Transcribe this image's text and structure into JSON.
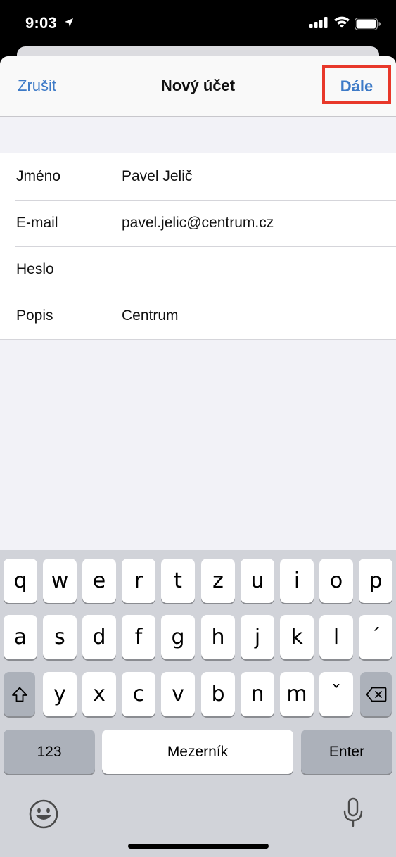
{
  "status": {
    "time": "9:03"
  },
  "nav": {
    "cancel_label": "Zrušit",
    "title": "Nový účet",
    "next_label": "Dále",
    "accent_color": "#3d7ac7",
    "highlight_color": "#e8382a"
  },
  "form": {
    "rows": [
      {
        "label": "Jméno",
        "value": "Pavel Jelič"
      },
      {
        "label": "E-mail",
        "value": "pavel.jelic@centrum.cz"
      },
      {
        "label": "Heslo",
        "value": ""
      },
      {
        "label": "Popis",
        "value": "Centrum"
      }
    ]
  },
  "keyboard": {
    "row1": [
      "q",
      "w",
      "e",
      "r",
      "t",
      "z",
      "u",
      "i",
      "o",
      "p"
    ],
    "row2": [
      "a",
      "s",
      "d",
      "f",
      "g",
      "h",
      "j",
      "k",
      "l",
      "´"
    ],
    "row3": [
      "y",
      "x",
      "c",
      "v",
      "b",
      "n",
      "m",
      "ˇ"
    ],
    "numbers_label": "123",
    "space_label": "Mezerník",
    "enter_label": "Enter"
  }
}
